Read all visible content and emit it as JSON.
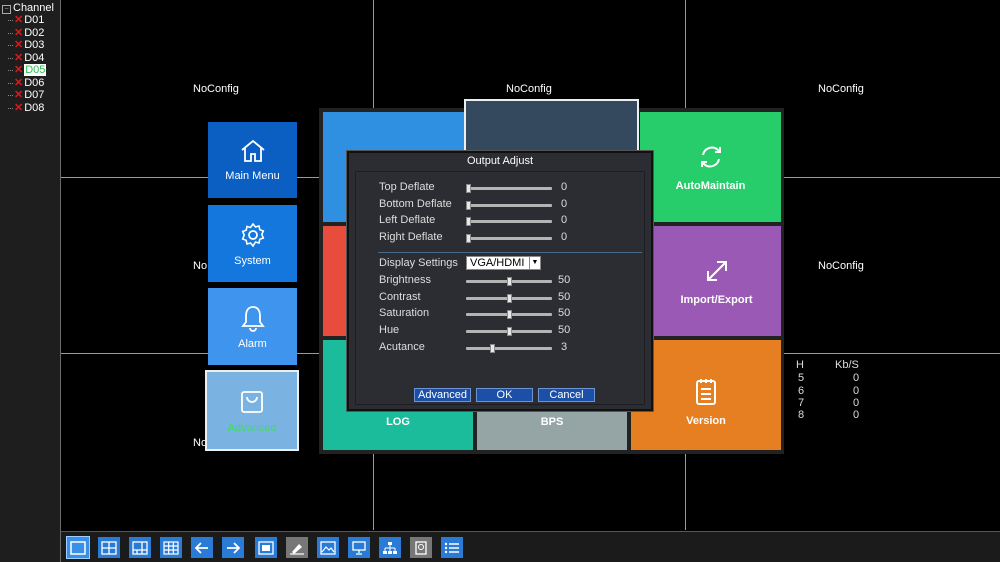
{
  "channel_tree": {
    "root_label": "Channel",
    "expand_icon": "minus-box-icon",
    "items": [
      {
        "label": "D01",
        "selected": false
      },
      {
        "label": "D02",
        "selected": false
      },
      {
        "label": "D03",
        "selected": false
      },
      {
        "label": "D04",
        "selected": false
      },
      {
        "label": "D05",
        "selected": true
      },
      {
        "label": "D06",
        "selected": false
      },
      {
        "label": "D07",
        "selected": false
      },
      {
        "label": "D08",
        "selected": false
      }
    ]
  },
  "channels": {
    "noconfig_label": "NoConfig",
    "partial_label": "No"
  },
  "menu_tiles": {
    "main_menu": {
      "label": "Main Menu",
      "icon": "home-icon",
      "color": "#0b5fc2"
    },
    "system": {
      "label": "System",
      "icon": "gear-icon",
      "color": "#1477dd"
    },
    "alarm": {
      "label": "Alarm",
      "icon": "bell-icon",
      "color": "#3f94ee"
    },
    "advanced": {
      "label": "Advanced",
      "icon": "bag-icon",
      "color": "#7ab2e2",
      "label_color": "#3be05a"
    },
    "automaintain": {
      "label": "AutoMaintain",
      "icon": "refresh-icon",
      "color": "#27cc6b"
    },
    "import_export": {
      "label": "Import/Export",
      "icon": "expand-arrows-icon",
      "color": "#9b59b6"
    },
    "version": {
      "label": "Version",
      "icon": "document-icon",
      "color": "#e67e22"
    },
    "log": {
      "label": "LOG",
      "color": "#1abc9c"
    },
    "bps": {
      "label": "BPS",
      "color": "#95a5a6"
    }
  },
  "output_adjust": {
    "title": "Output Adjust",
    "deflate_sliders": [
      {
        "label": "Top Deflate",
        "value": "0",
        "fraction": 0
      },
      {
        "label": "Bottom Deflate",
        "value": "0",
        "fraction": 0
      },
      {
        "label": "Left Deflate",
        "value": "0",
        "fraction": 0
      },
      {
        "label": "Right Deflate",
        "value": "0",
        "fraction": 0
      }
    ],
    "display_settings": {
      "label": "Display Settings",
      "selected": "VGA/HDMI"
    },
    "image_sliders": [
      {
        "label": "Brightness",
        "value": "50",
        "fraction": 0.5
      },
      {
        "label": "Contrast",
        "value": "50",
        "fraction": 0.5
      },
      {
        "label": "Saturation",
        "value": "50",
        "fraction": 0.5
      },
      {
        "label": "Hue",
        "value": "50",
        "fraction": 0.5
      },
      {
        "label": "Acutance",
        "value": "3",
        "fraction": 0.3
      }
    ],
    "buttons": {
      "advanced": "Advanced",
      "ok": "OK",
      "cancel": "Cancel"
    }
  },
  "bps_table": {
    "headers": [
      "H",
      "Kb/S"
    ],
    "rows": [
      [
        "5",
        "0"
      ],
      [
        "6",
        "0"
      ],
      [
        "7",
        "0"
      ],
      [
        "8",
        "0"
      ]
    ]
  },
  "toolbar": {
    "buttons": [
      "single-view-icon",
      "quad-view-icon",
      "six-view-icon",
      "nine-view-icon",
      "arrow-left-icon",
      "arrow-right-icon",
      "fullscreen-icon",
      "ptz-icon",
      "picture-color-icon",
      "output-icon",
      "network-icon",
      "hdd-icon",
      "menu-list-icon"
    ]
  }
}
